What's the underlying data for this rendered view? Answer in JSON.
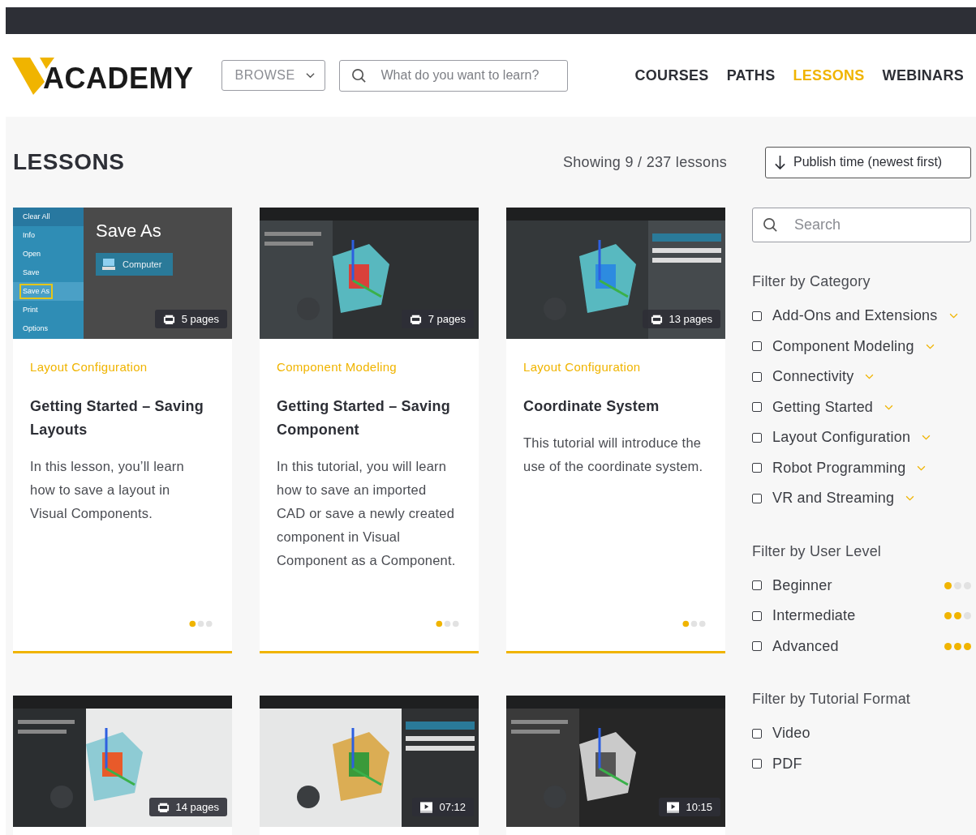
{
  "header": {
    "logo_text": "ACADEMY",
    "browse": "BROWSE",
    "search_placeholder": "What do you want to learn?",
    "nav": [
      {
        "label": "COURSES",
        "selected": false
      },
      {
        "label": "PATHS",
        "selected": false
      },
      {
        "label": "LESSONS",
        "selected": true
      },
      {
        "label": "WEBINARS",
        "selected": false
      }
    ]
  },
  "page": {
    "title": "LESSONS",
    "count": "Showing 9 / 237 lessons",
    "sort": "Publish time (newest first)"
  },
  "cards": [
    {
      "thumbnail": {
        "kind": "screen",
        "title": "Save As",
        "button": "Computer",
        "menu": [
          {
            "label": "Clear All",
            "selected": false
          },
          {
            "label": "Info",
            "selected": false
          },
          {
            "label": "Open",
            "selected": false
          },
          {
            "label": "Save",
            "selected": false
          },
          {
            "label": "Save As",
            "selected": true
          },
          {
            "label": "Print",
            "selected": false
          },
          {
            "label": "Options",
            "selected": false
          }
        ]
      },
      "badge": {
        "kind": "pdf",
        "text": "5 pages"
      },
      "category": "Layout Configuration",
      "title": "Getting Started – Saving Layouts",
      "description": "In this lesson, you’ll learn how to save a layout in Visual Components.",
      "stars": 1
    },
    {
      "badge": {
        "kind": "pdf",
        "text": "7 pages"
      },
      "category": "Component Modeling",
      "title": "Getting Started – Saving Component",
      "description": "In this tutorial, you will learn how to save an imported CAD or save a newly created component in Visual Component as a Component.",
      "stars": 1
    },
    {
      "badge": {
        "kind": "pdf",
        "text": "13 pages"
      },
      "category": "Layout Configuration",
      "title": "Coordinate System",
      "description": "This tutorial will introduce the use of the coordinate system.",
      "stars": 1
    },
    {
      "badge": {
        "kind": "pdf",
        "text": "14 pages"
      }
    },
    {
      "badge": {
        "kind": "video",
        "text": "07:12"
      }
    },
    {
      "badge": {
        "kind": "video",
        "text": "10:15"
      }
    }
  ],
  "sidebar": {
    "search_placeholder": "Search",
    "category_title": "Filter by Category",
    "categories": [
      {
        "label": "Add-Ons and Extensions",
        "checked": false
      },
      {
        "label": "Component Modeling",
        "checked": false
      },
      {
        "label": "Connectivity",
        "checked": false
      },
      {
        "label": "Getting Started",
        "checked": false
      },
      {
        "label": "Layout Configuration",
        "checked": false
      },
      {
        "label": "Robot Programming",
        "checked": false
      },
      {
        "label": "VR and Streaming",
        "checked": false
      }
    ],
    "level_title": "Filter by User Level",
    "levels": [
      {
        "label": "Beginner",
        "checked": false,
        "stars": 1
      },
      {
        "label": "Intermediate",
        "checked": false,
        "stars": 2
      },
      {
        "label": "Advanced",
        "checked": false,
        "stars": 3
      }
    ],
    "format_title": "Filter by Tutorial Format",
    "formats": [
      {
        "label": "Video",
        "checked": false
      },
      {
        "label": "PDF",
        "checked": false
      }
    ]
  }
}
